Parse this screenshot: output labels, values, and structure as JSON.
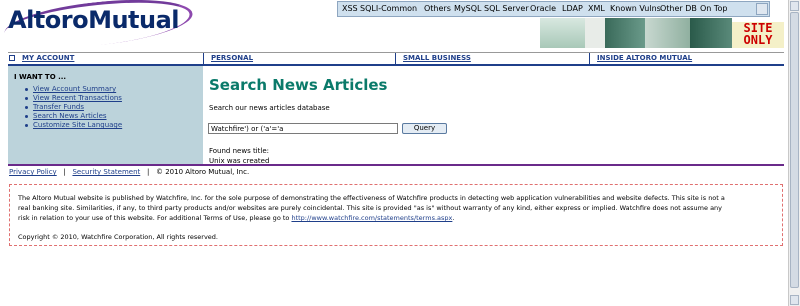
{
  "brand": {
    "logo_text": "AltoroMutual",
    "site_only_text": "SITE ONLY"
  },
  "toolbar": {
    "items": [
      "XSS",
      "SQLI-Common",
      "Others",
      "MySQL",
      "SQL Server",
      "Oracle",
      "LDAP",
      "XML",
      "Known Vulns",
      "Other DB",
      "On Top"
    ]
  },
  "nav": {
    "my_account": "MY ACCOUNT",
    "personal": "PERSONAL",
    "small_business": "SMALL BUSINESS",
    "inside": "INSIDE ALTORO MUTUAL"
  },
  "sidebar": {
    "heading": "I WANT TO ...",
    "items": [
      {
        "label": "View Account Summary"
      },
      {
        "label": "View Recent Transactions"
      },
      {
        "label": "Transfer Funds"
      },
      {
        "label": "Search News Articles"
      },
      {
        "label": "Customize Site Language"
      }
    ]
  },
  "main": {
    "title": "Search News Articles",
    "description": "Search our news articles database",
    "search_value": "Watchfire') or ('a'='a",
    "query_label": "Query",
    "result_label": "Found news title:",
    "result_value": "Unix was created"
  },
  "footer": {
    "privacy": "Privacy Policy",
    "sep1": "|",
    "security": "Security Statement",
    "sep2": "|",
    "copyright": "© 2010 Altoro Mutual, Inc."
  },
  "disclaimer": {
    "line1": "The Altoro Mutual website is published by Watchfire, Inc. for the sole purpose of demonstrating the effectiveness of Watchfire products in detecting web application vulnerabilities and website defects. This site is not a",
    "line2": "real banking site. Similarities, if any, to third party products and/or websites are purely coincidental. This site is provided \"as is\" without warranty of any kind, either express or implied. Watchfire does not assume any",
    "line3_text": "risk in relation to your use of this website. For additional Terms of Use, please go to ",
    "line3_link": "http://www.watchfire.com/statements/terms.aspx",
    "line3_end": ".",
    "copyright": "Copyright © 2010, Watchfire Corporation, All rights reserved."
  },
  "colors": {
    "nav_blue": "#1f3f8a",
    "title_teal": "#0a7a6a",
    "sidebar_bg": "#bcd3db",
    "accent_purple": "#6a2a8a",
    "site_only_red": "#cc0000"
  }
}
